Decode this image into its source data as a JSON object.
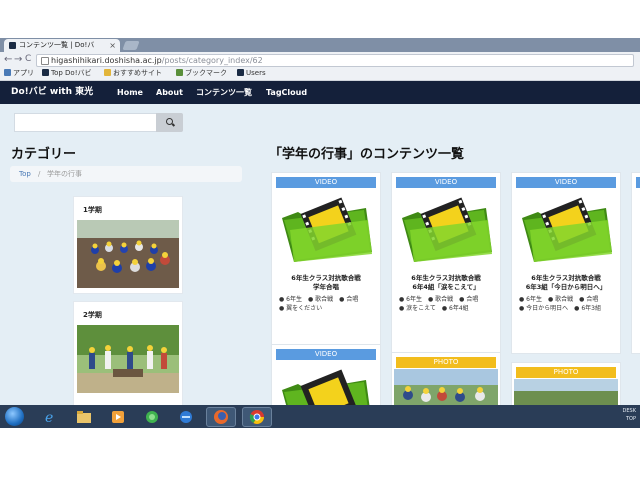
{
  "browser": {
    "tab_title": "コンテンツ一覧 | Do!バ",
    "tab_close": "×",
    "url_host": "higashihikari.doshisha.ac.jp",
    "url_path": "/posts/category_index/62",
    "back_glyph": "←",
    "forward_glyph": "→",
    "reload_glyph": "C",
    "bookmarks": [
      {
        "label": "アプリ",
        "icon": "apps-grid-icon",
        "color": "#4a7ab6"
      },
      {
        "label": "Top Do!バビ",
        "icon": "site-favicon-icon",
        "color": "#1a2b44"
      },
      {
        "label": "おすすめサイト",
        "icon": "folder-icon",
        "color": "#e2b53b"
      },
      {
        "label": "ブックマーク",
        "icon": "bookmark-icon",
        "color": "#5a8f3a"
      },
      {
        "label": "Users",
        "icon": "site-favicon-icon",
        "color": "#1a2b44"
      }
    ]
  },
  "site": {
    "brand": "Do!バビ with 東光",
    "nav": [
      "Home",
      "About",
      "コンテンツ一覧",
      "TagCloud"
    ],
    "nav_bg": "#14203a"
  },
  "sidebar": {
    "heading": "カテゴリー",
    "breadcrumb": {
      "home": "Top",
      "sep": "/",
      "current": "学年の行事"
    },
    "terms": [
      {
        "title": "1学期"
      },
      {
        "title": "2学期"
      }
    ]
  },
  "main": {
    "heading": "「学年の行事」のコンテンツ一覧",
    "cards": [
      {
        "badge": "VIDEO",
        "title": "6年生クラス対抗歌合戦\n学年合唱",
        "tags": [
          "6年生",
          "歌合戦",
          "合唱",
          "翼をください"
        ]
      },
      {
        "badge": "VIDEO",
        "title": "6年生クラス対抗歌合戦\n6年4組「涙をこえて」",
        "tags": [
          "6年生",
          "歌合戦",
          "合唱",
          "涙をこえて",
          "6年4組"
        ]
      },
      {
        "badge": "VIDEO",
        "title": "6年生クラス対抗歌合戦\n6年3組「今日から明日へ」",
        "tags": [
          "6年生",
          "歌合戦",
          "合唱",
          "今日から明日へ",
          "6年3組"
        ]
      },
      {
        "badge": "VIDEO"
      },
      {
        "badge": "PHOTO"
      },
      {
        "badge": "PHOTO"
      }
    ],
    "badge_video_color": "#5a9be0",
    "badge_photo_color": "#f2bd1d"
  },
  "taskbar": {
    "items": [
      "ie-icon",
      "explorer-icon",
      "media-player-icon",
      "games-icon",
      "network-icon",
      "firefox-icon",
      "chrome-icon"
    ],
    "tray_lines": [
      "DESK",
      "TOP"
    ]
  }
}
